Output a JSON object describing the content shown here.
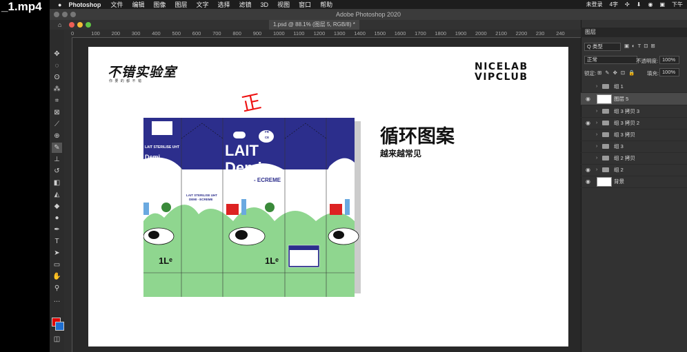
{
  "video": {
    "filename": "_1.mp4"
  },
  "menubar": {
    "app": "Photoshop",
    "items": [
      "文件",
      "编辑",
      "图像",
      "图层",
      "文字",
      "选择",
      "滤镜",
      "3D",
      "视图",
      "窗口",
      "帮助"
    ],
    "status_unsaved": "未登录",
    "status_chars": "4字",
    "status_afternoon": "下午"
  },
  "window": {
    "title": "Adobe Photoshop 2020",
    "doc_tab": "1.psd @ 88.1% (图层 5, RGB/8) *"
  },
  "ruler": {
    "ticks": [
      "0",
      "100",
      "200",
      "300",
      "400",
      "500",
      "600",
      "700",
      "800",
      "900",
      "1000",
      "1100",
      "1200",
      "1300",
      "1400",
      "1500",
      "1600",
      "1700",
      "1800",
      "1900",
      "2000",
      "2100",
      "2200",
      "230",
      "240"
    ]
  },
  "artwork": {
    "brand_cn": "不错实验室",
    "brand_sub": "你 要 的 都 不 错",
    "brand_en_line1": "NICELAB",
    "brand_en_line2": "VIPCLUB",
    "hand_mark": "正",
    "headline": "循环图案",
    "subhead": "越来越常见",
    "milk_lait": "LAIT",
    "milk_demi": "Demi",
    "milk_ecreme": "- ECREME",
    "milk_sterilise": "LAIT STERILISE UHT",
    "milk_demi_small": "Demi",
    "milk_ecreme_small": "- ECREME",
    "milk_side_title": "LAIT STERILISE UHT",
    "milk_side_sub": "DEMI - ECREME",
    "milk_volume": "1Lᵉ",
    "milk_fr": "FR",
    "milk_ce": "CE"
  },
  "panel": {
    "tab": "图层",
    "filter": "Q 类型",
    "blend_mode": "正常",
    "opacity_label": "不透明度:",
    "opacity_value": "100%",
    "lock_label": "锁定:",
    "fill_label": "填充:",
    "fill_value": "100%",
    "layers": [
      {
        "name": "组 1",
        "type": "group",
        "visible": false
      },
      {
        "name": "图层 5",
        "type": "layer",
        "visible": true,
        "active": true
      },
      {
        "name": "组 3 拷贝 3",
        "type": "group",
        "visible": false
      },
      {
        "name": "组 3 拷贝 2",
        "type": "group",
        "visible": true
      },
      {
        "name": "组 3 拷贝",
        "type": "group",
        "visible": false
      },
      {
        "name": "组 3",
        "type": "group",
        "visible": false
      },
      {
        "name": "组 2 拷贝",
        "type": "group",
        "visible": false
      },
      {
        "name": "组 2",
        "type": "group",
        "visible": true
      },
      {
        "name": "背景",
        "type": "layer",
        "visible": true
      }
    ]
  },
  "colors": {
    "milk_blue": "#2c2e8c",
    "milk_green": "#8fd68f",
    "fg_swatch": "#e00000",
    "bg_swatch": "#1f6fd1"
  }
}
